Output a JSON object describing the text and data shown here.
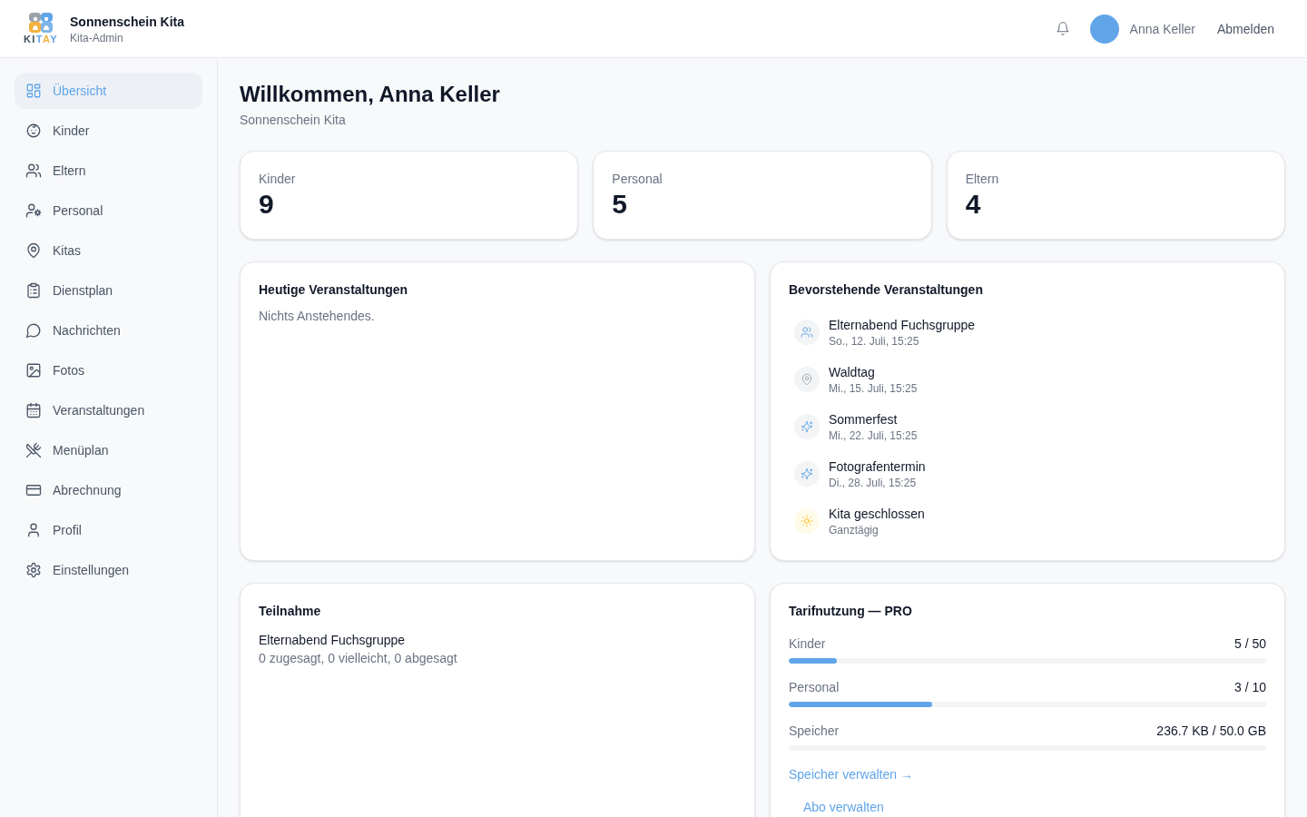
{
  "header": {
    "logo_text": "KITAY",
    "org_name": "Sonnenschein Kita",
    "role": "Kita-Admin",
    "user_name": "Anna Keller",
    "logout": "Abmelden"
  },
  "sidebar": {
    "items": [
      {
        "label": "Übersicht",
        "selected": true
      },
      {
        "label": "Kinder",
        "selected": false
      },
      {
        "label": "Eltern",
        "selected": false
      },
      {
        "label": "Personal",
        "selected": false
      },
      {
        "label": "Kitas",
        "selected": false
      },
      {
        "label": "Dienstplan",
        "selected": false
      },
      {
        "label": "Nachrichten",
        "selected": false
      },
      {
        "label": "Fotos",
        "selected": false
      },
      {
        "label": "Veranstaltungen",
        "selected": false
      },
      {
        "label": "Menüplan",
        "selected": false
      },
      {
        "label": "Abrechnung",
        "selected": false
      },
      {
        "label": "Profil",
        "selected": false
      },
      {
        "label": "Einstellungen",
        "selected": false
      }
    ]
  },
  "welcome": {
    "title": "Willkommen, Anna Keller",
    "subtitle": "Sonnenschein Kita"
  },
  "stats": [
    {
      "label": "Kinder",
      "value": "9"
    },
    {
      "label": "Personal",
      "value": "5"
    },
    {
      "label": "Eltern",
      "value": "4"
    }
  ],
  "today_events": {
    "title": "Heutige Veranstaltungen",
    "empty_text": "Nichts Anstehendes."
  },
  "upcoming_events": {
    "title": "Bevorstehende Veranstaltungen",
    "items": [
      {
        "kind": "meeting",
        "title": "Elternabend Fuchsgruppe",
        "time": "So., 12. Juli, 15:25"
      },
      {
        "kind": "excursion",
        "title": "Waldtag",
        "time": "Mi., 15. Juli, 15:25"
      },
      {
        "kind": "celebration",
        "title": "Sommerfest",
        "time": "Mi., 22. Juli, 15:25"
      },
      {
        "kind": "celebration",
        "title": "Fotografentermin",
        "time": "Di., 28. Juli, 15:25"
      },
      {
        "kind": "closure",
        "title": "Kita geschlossen",
        "time": "Ganztägig"
      }
    ]
  },
  "attendance": {
    "title": "Teilnahme",
    "items": [
      {
        "event": "Elternabend Fuchsgruppe",
        "summary": "0 zugesagt, 0 vielleicht, 0 abgesagt"
      }
    ]
  },
  "plan_usage": {
    "title": "Tarifnutzung — PRO",
    "meters": [
      {
        "label": "Kinder",
        "reading": "5 / 50",
        "level": 0.1
      },
      {
        "label": "Personal",
        "reading": "3 / 10",
        "level": 0.3
      },
      {
        "label": "Speicher",
        "reading": "236.7 KB / 50.0 GB"
      }
    ],
    "storage_link": "Speicher verwalten →",
    "subscription_link": "Abo verwalten"
  }
}
